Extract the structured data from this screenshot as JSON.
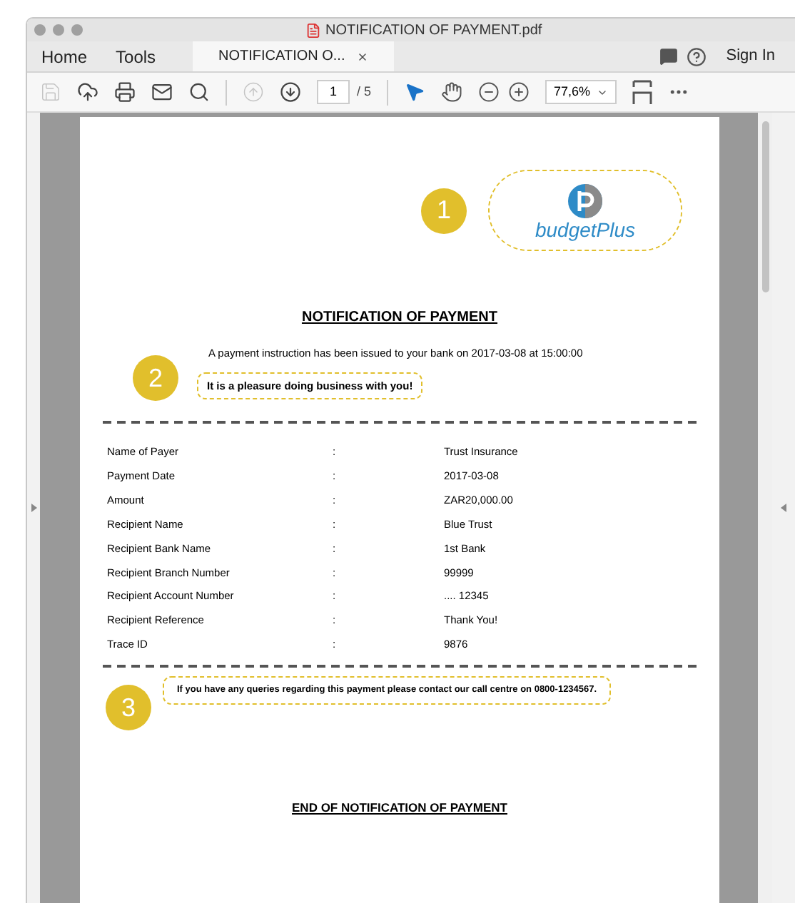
{
  "window": {
    "title": "NOTIFICATION OF PAYMENT.pdf"
  },
  "tabs": [
    {
      "label": "Home",
      "selected": false,
      "kind": "nav"
    },
    {
      "label": "Tools",
      "selected": false,
      "kind": "nav"
    },
    {
      "label": "NOTIFICATION O...",
      "selected": true,
      "kind": "document"
    }
  ],
  "sign_in": "Sign In",
  "toolbar": {
    "buttons": [
      {
        "kind": "save",
        "disabled": true
      },
      {
        "kind": "upload",
        "disabled": false
      },
      {
        "kind": "print",
        "disabled": false
      },
      {
        "kind": "mail",
        "disabled": false
      },
      {
        "kind": "search",
        "disabled": false
      }
    ],
    "nav_buttons": [
      {
        "kind": "prev",
        "disabled": true
      },
      {
        "kind": "next",
        "disabled": false
      }
    ],
    "page": "1",
    "page_total": "/ 5",
    "tools": [
      {
        "kind": "select",
        "selected": true
      },
      {
        "kind": "hand",
        "selected": false
      }
    ],
    "zoom": "77,6%"
  },
  "document": {
    "logo": "budgetPlus",
    "callouts": [
      "1",
      "2",
      "3"
    ],
    "title": "NOTIFICATION OF PAYMENT",
    "intro": "A payment instruction has been issued to your bank on 2017-03-08 at 15:00:00",
    "highlight": "It is a pleasure doing business with you!",
    "rows": [
      {
        "label": "Name of Payer",
        "sep": ":",
        "value": "Trust Insurance"
      },
      {
        "label": "Payment Date",
        "sep": ":",
        "value": "2017-03-08"
      },
      {
        "label": "Amount",
        "sep": ":",
        "value": "ZAR20,000.00"
      },
      {
        "label": "Recipient Name",
        "sep": ":",
        "value": "Blue Trust"
      },
      {
        "label": "Recipient Bank Name",
        "sep": ":",
        "value": "1st Bank"
      },
      {
        "label": "Recipient Branch Number",
        "sep": ":",
        "value": "99999"
      },
      {
        "label": "Recipient Account Number",
        "sep": ":",
        "value": ".... 12345"
      },
      {
        "label": "Recipient Reference",
        "sep": ":",
        "value": "Thank You!"
      },
      {
        "label": "Trace ID",
        "sep": ":",
        "value": "9876"
      }
    ],
    "contact": "If you have any queries regarding this payment please contact our call centre on 0800-1234567.",
    "end_title": "END OF NOTIFICATION OF PAYMENT"
  }
}
